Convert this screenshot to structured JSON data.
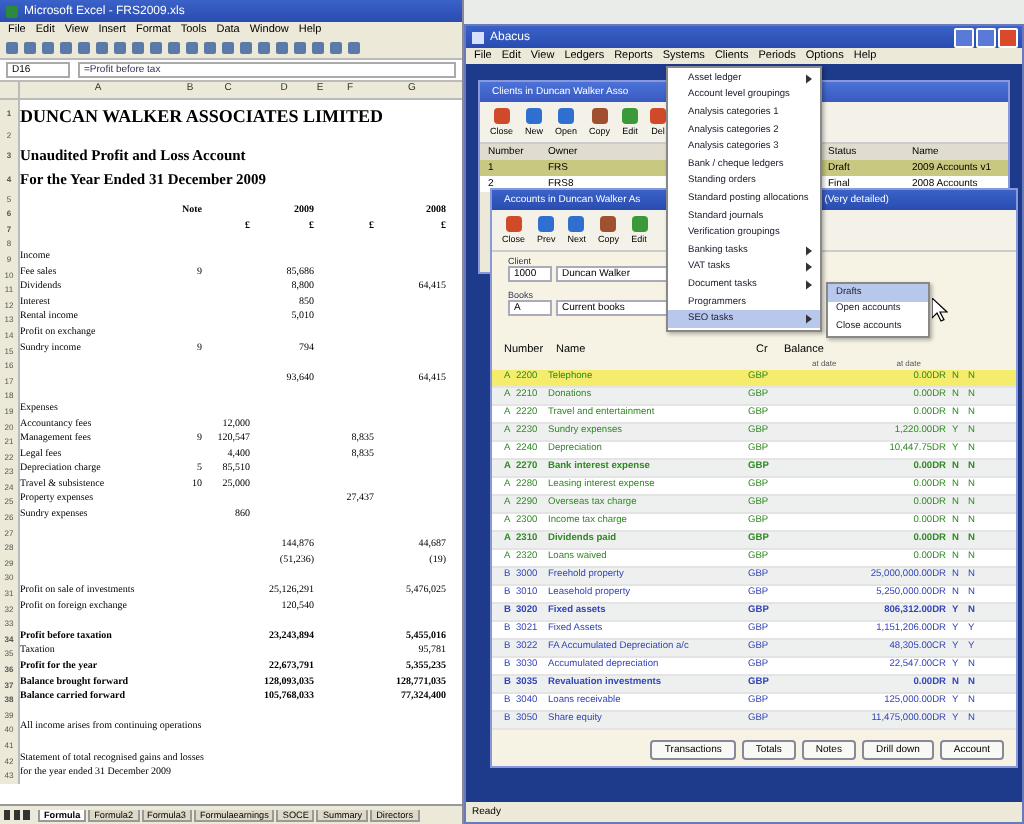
{
  "excel": {
    "title": "Microsoft Excel - FRS2009.xls",
    "menu": [
      "File",
      "Edit",
      "View",
      "Insert",
      "Format",
      "Tools",
      "Data",
      "Window",
      "Help"
    ],
    "cell_ref": "D16",
    "formula": "=Profit before tax",
    "columns": [
      "A",
      "B",
      "C",
      "D",
      "E",
      "F",
      "G"
    ],
    "rows": [
      {
        "n": "1",
        "kind": "title",
        "a": "DUNCAN WALKER ASSOCIATES LIMITED"
      },
      {
        "n": "2",
        "kind": "blank"
      },
      {
        "n": "3",
        "kind": "subtitle",
        "a": "Unaudited Profit and Loss Account"
      },
      {
        "n": "4",
        "kind": "subtitle",
        "a": "For the Year Ended 31 December 2009"
      },
      {
        "n": "5",
        "kind": "blank"
      },
      {
        "n": "6",
        "kind": "header",
        "b": "Note",
        "d": "2009",
        "g": "2008"
      },
      {
        "n": "7",
        "kind": "header",
        "c": "£",
        "d": "£",
        "f": "£",
        "g": "£"
      },
      {
        "n": "8",
        "kind": "blank"
      },
      {
        "n": "9",
        "kind": "normal",
        "a": "Income"
      },
      {
        "n": "10",
        "kind": "normal",
        "a": "Fee sales",
        "b": "9",
        "d": "85,686"
      },
      {
        "n": "11",
        "kind": "normal",
        "a": "Dividends",
        "d": "8,800",
        "g": "64,415"
      },
      {
        "n": "12",
        "kind": "normal",
        "a": "Interest",
        "d": "850"
      },
      {
        "n": "13",
        "kind": "normal",
        "a": "Rental income",
        "d": "5,010"
      },
      {
        "n": "14",
        "kind": "normal",
        "a": "Profit on exchange"
      },
      {
        "n": "15",
        "kind": "normal",
        "a": "Sundry income",
        "b": "9",
        "d": "794"
      },
      {
        "n": "16",
        "kind": "blank"
      },
      {
        "n": "17",
        "kind": "normal",
        "d": "93,640",
        "g": "64,415"
      },
      {
        "n": "18",
        "kind": "blank"
      },
      {
        "n": "19",
        "kind": "normal",
        "a": "Expenses"
      },
      {
        "n": "20",
        "kind": "normal",
        "a": "Accountancy fees",
        "c": "12,000"
      },
      {
        "n": "21",
        "kind": "normal",
        "a": "Management fees",
        "b": "9",
        "c": "120,547",
        "f": "8,835"
      },
      {
        "n": "22",
        "kind": "normal",
        "a": "Legal fees",
        "c": "4,400",
        "f": "8,835"
      },
      {
        "n": "23",
        "kind": "normal",
        "a": "Depreciation charge",
        "b": "5",
        "c": "85,510"
      },
      {
        "n": "24",
        "kind": "normal",
        "a": "Travel & subsistence",
        "b": "10",
        "c": "25,000"
      },
      {
        "n": "25",
        "kind": "normal",
        "a": "Property expenses",
        "f": "27,437"
      },
      {
        "n": "26",
        "kind": "normal",
        "a": "Sundry expenses",
        "c": "860"
      },
      {
        "n": "27",
        "kind": "blank"
      },
      {
        "n": "28",
        "kind": "normal",
        "d": "144,876",
        "g": "44,687"
      },
      {
        "n": "29",
        "kind": "normal",
        "d": "(51,236)",
        "g": "(19)"
      },
      {
        "n": "30",
        "kind": "blank"
      },
      {
        "n": "31",
        "kind": "normal",
        "a": "Profit on sale of investments",
        "d": "25,126,291",
        "g": "5,476,025"
      },
      {
        "n": "32",
        "kind": "normal",
        "a": "Profit on foreign exchange",
        "d": "120,540"
      },
      {
        "n": "33",
        "kind": "blank"
      },
      {
        "n": "34",
        "kind": "bold",
        "a": "Profit before taxation",
        "d": "23,243,894",
        "g": "5,455,016"
      },
      {
        "n": "35",
        "kind": "normal",
        "a": "Taxation",
        "g": "95,781"
      },
      {
        "n": "36",
        "kind": "bold",
        "a": "Profit for the year",
        "d": "22,673,791",
        "g": "5,355,235"
      },
      {
        "n": "37",
        "kind": "bold",
        "a": "Balance brought forward",
        "d": "128,093,035",
        "g": "128,771,035"
      },
      {
        "n": "38",
        "kind": "bold",
        "a": "Balance carried forward",
        "d": "105,768,033",
        "g": "77,324,400"
      },
      {
        "n": "39",
        "kind": "blank"
      },
      {
        "n": "40",
        "kind": "normal",
        "a": "All income arises from continuing operations"
      },
      {
        "n": "41",
        "kind": "blank"
      },
      {
        "n": "42",
        "kind": "normal",
        "a": "Statement of total recognised gains and losses"
      },
      {
        "n": "43",
        "kind": "normal",
        "a": "for the year ended 31 December 2009"
      }
    ],
    "sheet_tabs": [
      {
        "label": "Formula",
        "selected": true
      },
      {
        "label": "Formula2",
        "selected": false
      },
      {
        "label": "Formula3",
        "selected": false
      },
      {
        "label": "Formulaearnings",
        "selected": false
      },
      {
        "label": "SOCE",
        "selected": false
      },
      {
        "label": "Summary",
        "selected": false
      },
      {
        "label": "Directors",
        "selected": false
      }
    ]
  },
  "app": {
    "title": "Abacus",
    "menu": [
      "File",
      "Edit",
      "View",
      "Ledgers",
      "Reports",
      "Systems",
      "Clients",
      "Periods",
      "Options",
      "Help"
    ],
    "back_window": {
      "title": "Clients in Duncan Walker Asso",
      "toolbar": [
        {
          "label": "Close",
          "color": "#d04a2a"
        },
        {
          "label": "New",
          "color": "#2f6fd0"
        },
        {
          "label": "Open",
          "color": "#2f6fd0"
        },
        {
          "label": "Copy",
          "color": "#a05030"
        },
        {
          "label": "Edit",
          "color": "#3a9a3a"
        },
        {
          "label": "Del",
          "color": "#d04a2a"
        }
      ],
      "columns": [
        "Number",
        "Owner",
        "Status",
        "Name"
      ],
      "rows": [
        {
          "number": "1",
          "owner": "FRS",
          "status": "Draft",
          "name": "2009 Accounts v1",
          "selected": true
        },
        {
          "number": "2",
          "owner": "FRS8",
          "status": "Final",
          "name": "2008 Accounts",
          "selected": false
        }
      ]
    },
    "front_window": {
      "title": "Accounts in Duncan Walker As",
      "mode": "(Very detailed)",
      "toolbar": [
        {
          "label": "Close",
          "color": "#d04a2a"
        },
        {
          "label": "Prev",
          "color": "#2f6fd0"
        },
        {
          "label": "Next",
          "color": "#2f6fd0"
        },
        {
          "label": "Copy",
          "color": "#a05030"
        },
        {
          "label": "Edit",
          "color": "#3a9a3a"
        }
      ],
      "fields": [
        {
          "label": "Client",
          "code": "1000",
          "value": "Duncan Walker"
        },
        {
          "label": "Books",
          "code": "A",
          "value": "Current books"
        }
      ],
      "columns": [
        "Number",
        "Name",
        "Cr",
        "Balance"
      ],
      "subheads": [
        "at date",
        "at date"
      ],
      "rows": [
        {
          "type": "A",
          "number": "2200",
          "name": "Telephone",
          "currency": "GBP",
          "balance": "0.00DR",
          "f1": "N",
          "f2": "N",
          "kind": "profit_loss",
          "bold": false,
          "selected": true
        },
        {
          "type": "A",
          "number": "2210",
          "name": "Donations",
          "currency": "GBP",
          "balance": "0.00DR",
          "f1": "N",
          "f2": "N",
          "kind": "profit_loss",
          "bold": false,
          "selected": false
        },
        {
          "type": "A",
          "number": "2220",
          "name": "Travel and entertainment",
          "currency": "GBP",
          "balance": "0.00DR",
          "f1": "N",
          "f2": "N",
          "kind": "profit_loss",
          "bold": false,
          "selected": false
        },
        {
          "type": "A",
          "number": "2230",
          "name": "Sundry expenses",
          "currency": "GBP",
          "balance": "1,220.00DR",
          "f1": "Y",
          "f2": "N",
          "kind": "profit_loss",
          "bold": false,
          "selected": false
        },
        {
          "type": "A",
          "number": "2240",
          "name": "Depreciation",
          "currency": "GBP",
          "balance": "10,447.75DR",
          "f1": "Y",
          "f2": "N",
          "kind": "profit_loss",
          "bold": false,
          "selected": false
        },
        {
          "type": "A",
          "number": "2270",
          "name": "Bank interest expense",
          "currency": "GBP",
          "balance": "0.00DR",
          "f1": "N",
          "f2": "N",
          "kind": "profit_loss",
          "bold": true,
          "selected": false
        },
        {
          "type": "A",
          "number": "2280",
          "name": "Leasing interest expense",
          "currency": "GBP",
          "balance": "0.00DR",
          "f1": "N",
          "f2": "N",
          "kind": "profit_loss",
          "bold": false,
          "selected": false
        },
        {
          "type": "A",
          "number": "2290",
          "name": "Overseas tax charge",
          "currency": "GBP",
          "balance": "0.00DR",
          "f1": "N",
          "f2": "N",
          "kind": "profit_loss",
          "bold": false,
          "selected": false
        },
        {
          "type": "A",
          "number": "2300",
          "name": "Income tax charge",
          "currency": "GBP",
          "balance": "0.00DR",
          "f1": "N",
          "f2": "N",
          "kind": "profit_loss",
          "bold": false,
          "selected": false
        },
        {
          "type": "A",
          "number": "2310",
          "name": "Dividends paid",
          "currency": "GBP",
          "balance": "0.00DR",
          "f1": "N",
          "f2": "N",
          "kind": "profit_loss",
          "bold": true,
          "selected": false
        },
        {
          "type": "A",
          "number": "2320",
          "name": "Loans waived",
          "currency": "GBP",
          "balance": "0.00DR",
          "f1": "N",
          "f2": "N",
          "kind": "profit_loss",
          "bold": false,
          "selected": false
        },
        {
          "type": "B",
          "number": "3000",
          "name": "Freehold property",
          "currency": "GBP",
          "balance": "25,000,000.00DR",
          "f1": "N",
          "f2": "N",
          "kind": "balance_sheet",
          "bold": false,
          "selected": false
        },
        {
          "type": "B",
          "number": "3010",
          "name": "Leasehold property",
          "currency": "GBP",
          "balance": "5,250,000.00DR",
          "f1": "N",
          "f2": "N",
          "kind": "balance_sheet",
          "bold": false,
          "selected": false
        },
        {
          "type": "B",
          "number": "3020",
          "name": "Fixed assets",
          "currency": "GBP",
          "balance": "806,312.00DR",
          "f1": "Y",
          "f2": "N",
          "kind": "balance_sheet",
          "bold": true,
          "selected": false
        },
        {
          "type": "B",
          "number": "3021",
          "name": "Fixed Assets",
          "currency": "GBP",
          "balance": "1,151,206.00DR",
          "f1": "Y",
          "f2": "Y",
          "kind": "balance_sheet",
          "bold": false,
          "selected": false
        },
        {
          "type": "B",
          "number": "3022",
          "name": "FA Accumulated Depreciation a/c",
          "currency": "GBP",
          "balance": "48,305.00CR",
          "f1": "Y",
          "f2": "Y",
          "kind": "balance_sheet",
          "bold": false,
          "selected": false
        },
        {
          "type": "B",
          "number": "3030",
          "name": "Accumulated depreciation",
          "currency": "GBP",
          "balance": "22,547.00CR",
          "f1": "Y",
          "f2": "N",
          "kind": "balance_sheet",
          "bold": false,
          "selected": false
        },
        {
          "type": "B",
          "number": "3035",
          "name": "Revaluation investments",
          "currency": "GBP",
          "balance": "0.00DR",
          "f1": "N",
          "f2": "N",
          "kind": "balance_sheet",
          "bold": true,
          "selected": false
        },
        {
          "type": "B",
          "number": "3040",
          "name": "Loans receivable",
          "currency": "GBP",
          "balance": "125,000.00DR",
          "f1": "Y",
          "f2": "N",
          "kind": "balance_sheet",
          "bold": false,
          "selected": false
        },
        {
          "type": "B",
          "number": "3050",
          "name": "Share equity",
          "currency": "GBP",
          "balance": "11,475,000.00DR",
          "f1": "Y",
          "f2": "N",
          "kind": "balance_sheet",
          "bold": false,
          "selected": false
        }
      ],
      "buttons": [
        "Transactions",
        "Totals",
        "Notes",
        "Drill down",
        "Account"
      ]
    },
    "dropdown": {
      "items": [
        {
          "label": "Asset ledger",
          "submenu": true,
          "selected": false
        },
        {
          "label": "Account level groupings",
          "submenu": false,
          "selected": false
        },
        {
          "label": "Analysis categories 1",
          "submenu": false,
          "selected": false
        },
        {
          "label": "Analysis categories 2",
          "submenu": false,
          "selected": false
        },
        {
          "label": "Analysis categories 3",
          "submenu": false,
          "selected": false
        },
        {
          "label": "Bank / cheque ledgers",
          "submenu": false,
          "selected": false
        },
        {
          "label": "Standing orders",
          "submenu": false,
          "selected": false
        },
        {
          "label": "Standard posting allocations",
          "submenu": false,
          "selected": false
        },
        {
          "label": "Standard journals",
          "submenu": false,
          "selected": false
        },
        {
          "label": "Verification groupings",
          "submenu": false,
          "selected": false
        },
        {
          "label": "Banking tasks",
          "submenu": true,
          "selected": false
        },
        {
          "label": "VAT tasks",
          "submenu": true,
          "selected": false
        },
        {
          "label": "Document tasks",
          "submenu": true,
          "selected": false
        },
        {
          "label": "Programmers",
          "submenu": false,
          "selected": false
        },
        {
          "label": "SEO tasks",
          "submenu": true,
          "selected": true
        }
      ],
      "submenu": [
        {
          "label": "Drafts",
          "selected": true
        },
        {
          "label": "Open accounts",
          "selected": false
        },
        {
          "label": "Close accounts",
          "selected": false
        }
      ]
    },
    "status_bar": "Ready"
  }
}
